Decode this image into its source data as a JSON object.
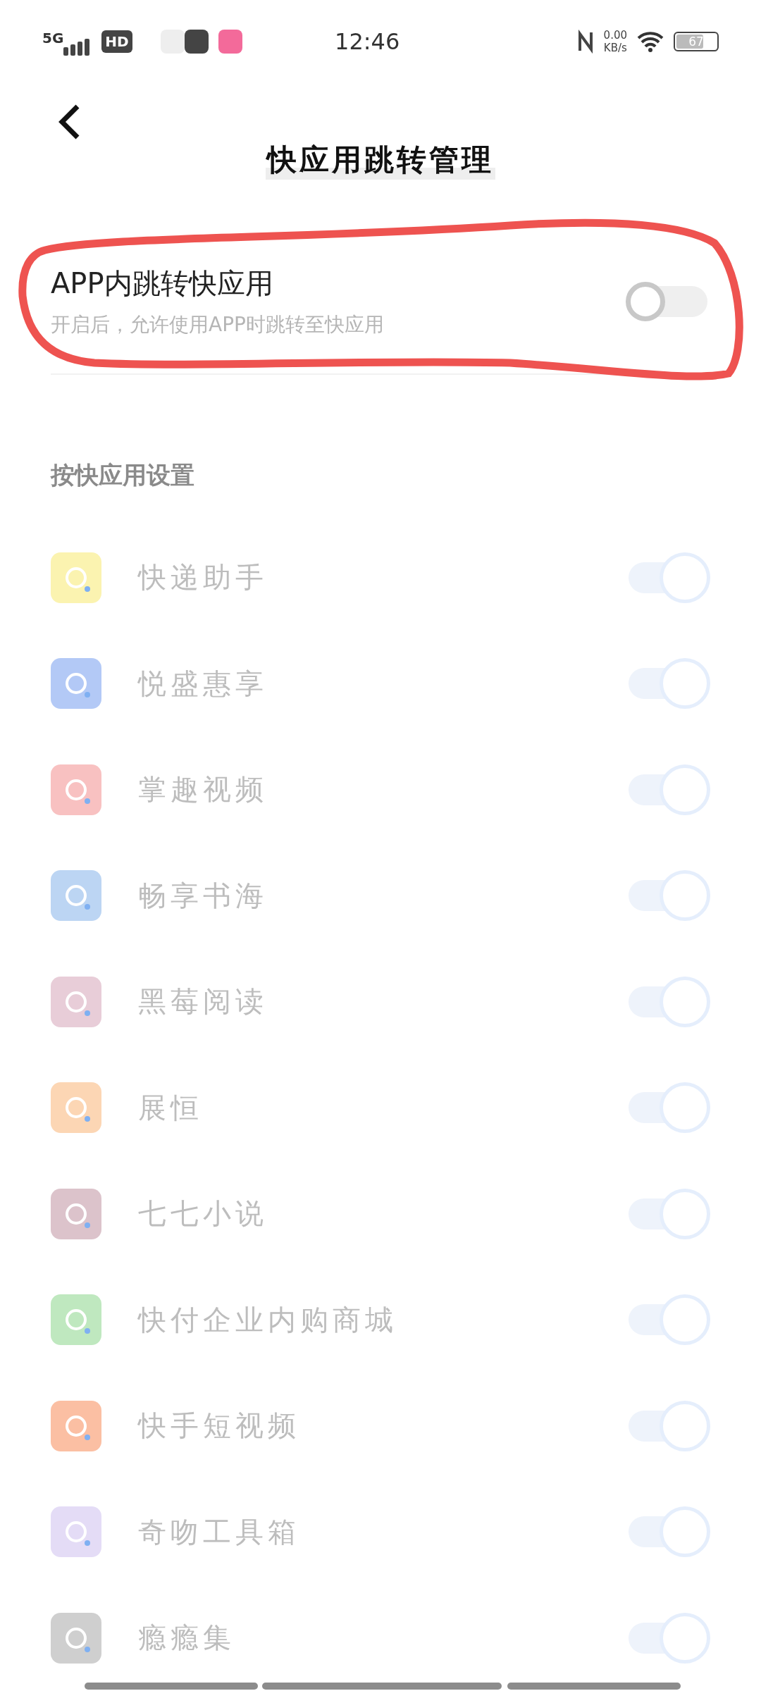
{
  "status_bar": {
    "network": "5G",
    "hd": "HD",
    "time": "12:46",
    "speed_value": "0.00",
    "speed_unit": "KB/s",
    "battery": "67",
    "level": 0.67
  },
  "header": {
    "title": "快应用跳转管理"
  },
  "master_toggle": {
    "title": "APP内跳转快应用",
    "subtitle": "开启后，允许使用APP时跳转至快应用",
    "on": false
  },
  "section_title": "按快应用设置",
  "apps": [
    {
      "name": "快递助手",
      "color": "#fbf3b0",
      "on": true,
      "disabled": true
    },
    {
      "name": "悦盛惠享",
      "color": "#b3c9f6",
      "on": true,
      "disabled": true
    },
    {
      "name": "掌趣视频",
      "color": "#f8c1c1",
      "on": true,
      "disabled": true
    },
    {
      "name": "畅享书海",
      "color": "#bcd5f3",
      "on": true,
      "disabled": true
    },
    {
      "name": "黑莓阅读",
      "color": "#e8cdd8",
      "on": true,
      "disabled": true
    },
    {
      "name": "展恒",
      "color": "#fcd6b4",
      "on": true,
      "disabled": true
    },
    {
      "name": "七七小说",
      "color": "#dcc3cb",
      "on": true,
      "disabled": true
    },
    {
      "name": "快付企业内购商城",
      "color": "#bfe8bf",
      "on": true,
      "disabled": true
    },
    {
      "name": "快手短视频",
      "color": "#fbbfa3",
      "on": true,
      "disabled": true
    },
    {
      "name": "奇吻工具箱",
      "color": "#e4dcf6",
      "on": true,
      "disabled": true
    },
    {
      "name": "瘾瘾集",
      "color": "#cfcfcf",
      "on": true,
      "disabled": true
    }
  ]
}
